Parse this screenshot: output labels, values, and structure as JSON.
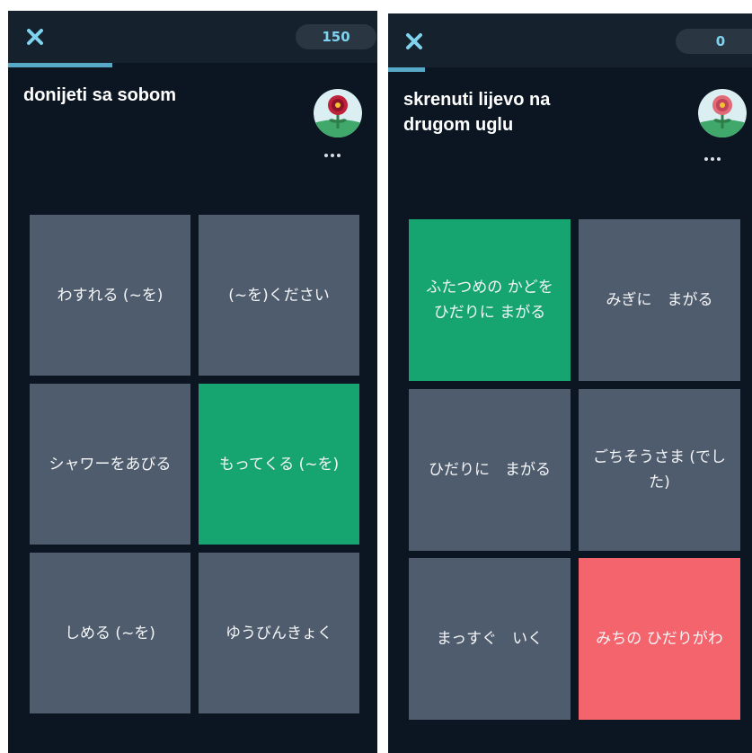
{
  "left_card": {
    "score": "150",
    "progress": 0.28,
    "prompt": "donijeti sa sobom",
    "tiles": [
      {
        "label": "わすれる (~を)",
        "state": "default"
      },
      {
        "label": "(~を)ください",
        "state": "default"
      },
      {
        "label": "シャワーをあびる",
        "state": "default"
      },
      {
        "label": "もってくる (~を)",
        "state": "correct"
      },
      {
        "label": "しめる (~を)",
        "state": "default"
      },
      {
        "label": "ゆうびんきょく",
        "state": "default"
      }
    ]
  },
  "right_card": {
    "score": "0",
    "progress": 0.1,
    "prompt_line1": "skrenuti lijevo na",
    "prompt_line2": "drugom uglu",
    "tiles": [
      {
        "label": "ふたつめの かどを ひだりに まがる",
        "state": "correct"
      },
      {
        "label": "みぎに　まがる",
        "state": "default"
      },
      {
        "label": "ひだりに　まがる",
        "state": "default"
      },
      {
        "label": "ごちそうさま (でした)",
        "state": "default"
      },
      {
        "label": "まっすぐ　いく",
        "state": "default"
      },
      {
        "label": "みちの ひだりがわ",
        "state": "wrong"
      }
    ]
  },
  "icons": {
    "close": "close-icon",
    "more": "more-options-icon",
    "avatar": "flower-avatar-icon"
  },
  "colors": {
    "background": "#0b1622",
    "topbar": "#15212c",
    "tile_default": "#4f5c6d",
    "tile_correct": "#16a571",
    "tile_wrong": "#f4646d",
    "accent": "#7fd3ee"
  }
}
